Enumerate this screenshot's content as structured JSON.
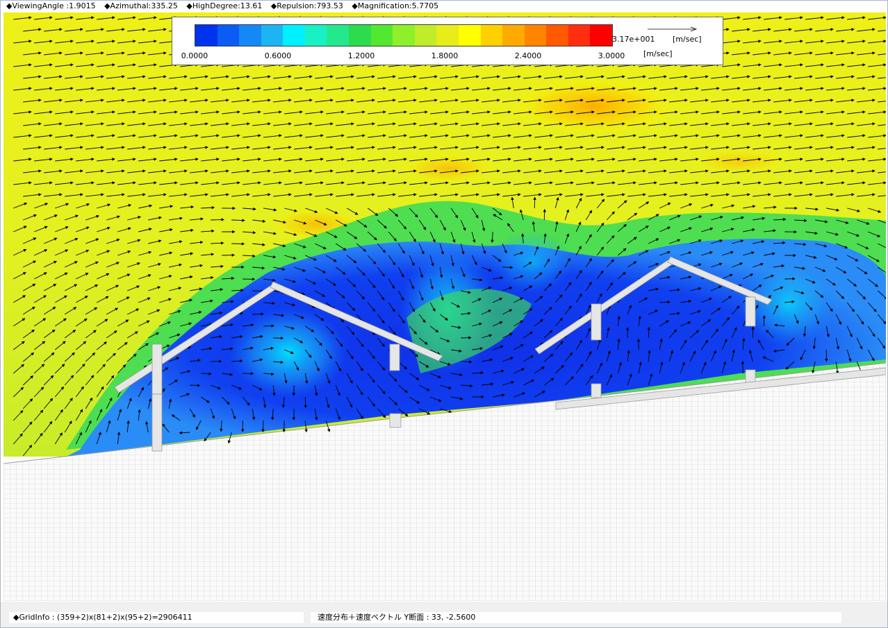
{
  "header": {
    "viewing_angle": "◆ViewingAngle :1.9015",
    "azimuthal": "◆Azimuthal:335.25",
    "high_degree": "◆HighDegree:13.61",
    "repulsion": "◆Repulsion:793.53",
    "magnification": "◆Magnification:5.7705"
  },
  "legend": {
    "colors": [
      "#0033ee",
      "#0a5cf5",
      "#1488f7",
      "#1db4f4",
      "#00f0ff",
      "#19f0c4",
      "#24e88e",
      "#2cdc4c",
      "#52e830",
      "#8ef02a",
      "#c0ec2a",
      "#e8ec1a",
      "#ffff00",
      "#ffd000",
      "#ffaa00",
      "#ff8400",
      "#ff5a00",
      "#ff2e10",
      "#ff0000"
    ],
    "tick_labels": [
      "0.0000",
      "0.6000",
      "1.2000",
      "1.8000",
      "2.4000",
      "3.0000"
    ],
    "ref_value": "3.17e+001",
    "ref_unit": "[m/sec]",
    "scale_unit": "[m/sec]",
    "min": 0.0,
    "max": 3.0
  },
  "footer": {
    "grid_info": "◆GridInfo : (359+2)x(81+2)x(95+2)=2906411",
    "section_info": "速度分布＋速度ベクトル Y断面 : 33,  -2.5600"
  }
}
